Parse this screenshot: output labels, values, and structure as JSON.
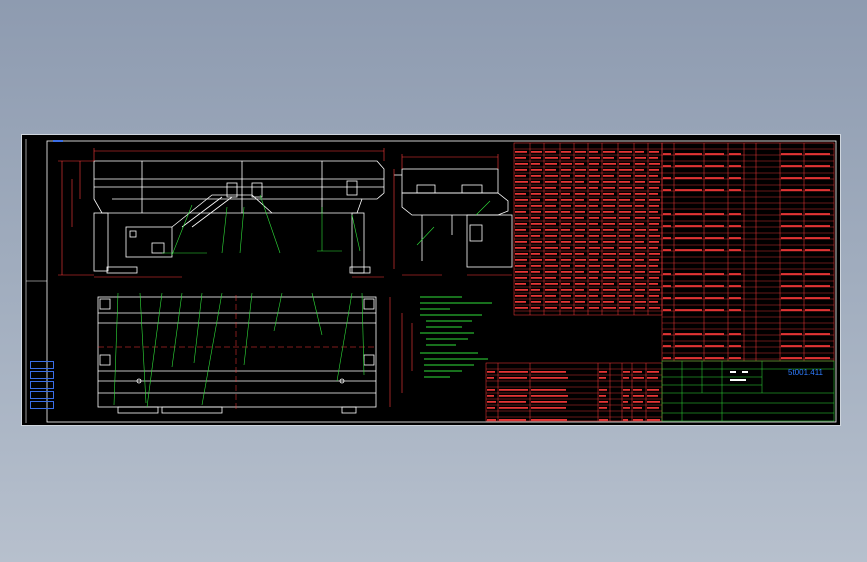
{
  "drawing": {
    "border_label": "",
    "drawing_number": "5t001.411",
    "colors": {
      "background": "#000000",
      "outline": "#ffffff",
      "dimension": "#ff3b3b",
      "leader": "#2fe03a",
      "frame_blue": "#3a6ee8",
      "title_text": "#2e7bff"
    }
  }
}
